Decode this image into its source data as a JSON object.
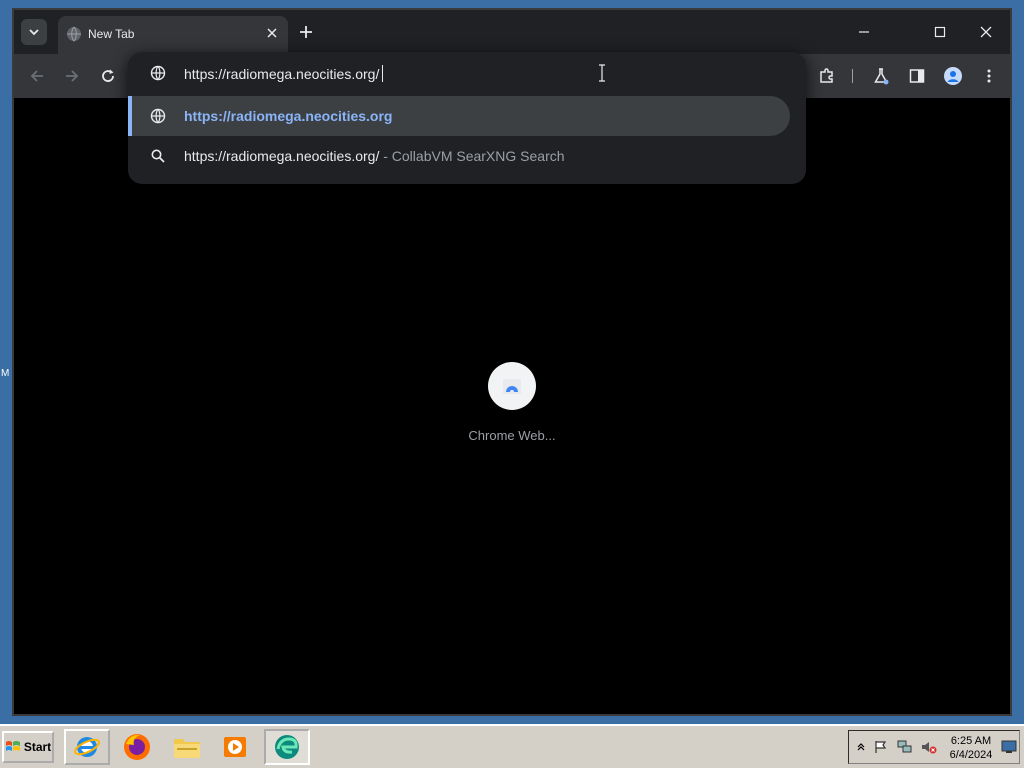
{
  "desktop": {
    "edge_label": "M"
  },
  "browser": {
    "tab": {
      "title": "New Tab"
    },
    "omnibox": {
      "value": "https://radiomega.neocities.org/",
      "suggestions": [
        {
          "text": "https://radiomega.neocities.org",
          "icon": "globe-icon"
        },
        {
          "text": "https://radiomega.neocities.org/",
          "description": " - CollabVM SearXNG Search",
          "icon": "search-icon"
        }
      ]
    },
    "content": {
      "loading_label": "Chrome Web..."
    }
  },
  "taskbar": {
    "start_label": "Start",
    "clock": {
      "time": "6:25 AM",
      "date": "6/4/2024"
    },
    "apps": [
      "internet-explorer-icon",
      "firefox-icon",
      "file-explorer-icon",
      "media-player-icon",
      "edge-icon"
    ]
  },
  "colors": {
    "accent": "#8ab4f8",
    "titlebar": "#202124",
    "toolbar": "#35363a",
    "desktop": "#3a6ea5",
    "taskbar": "#d4d0c8"
  }
}
